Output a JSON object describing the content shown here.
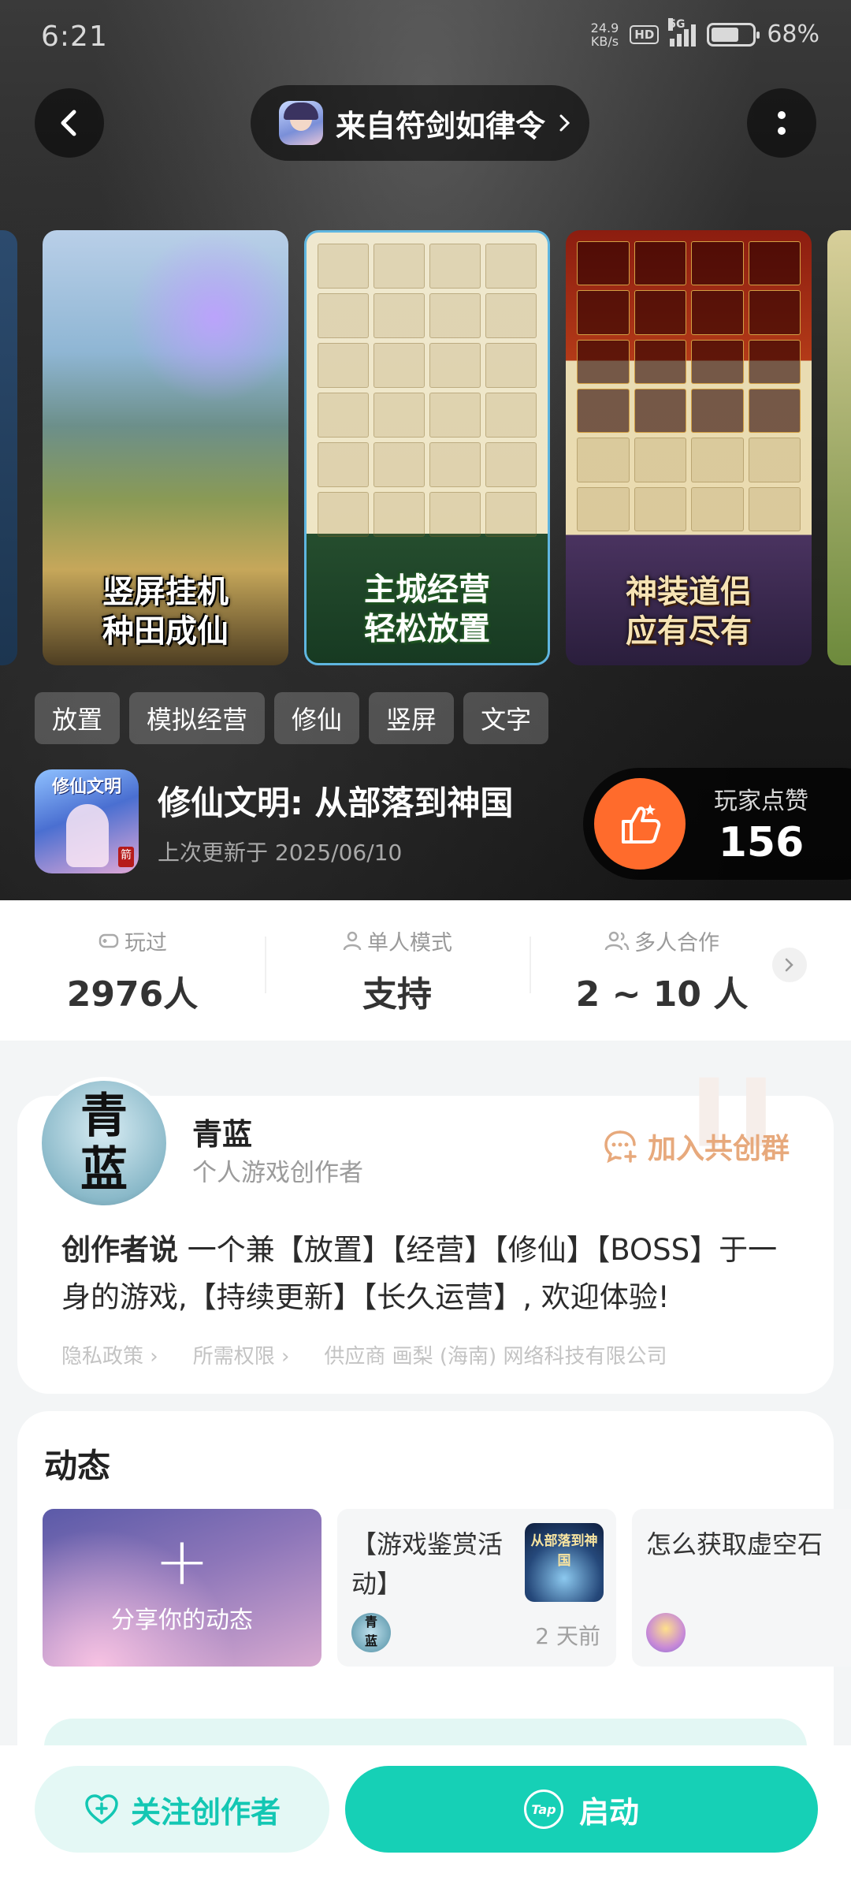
{
  "status_bar": {
    "time": "6:21",
    "network_speed": "24.9",
    "network_unit": "KB/s",
    "hd": "HD",
    "signal": "5G",
    "battery": "68%",
    "battery_level": 0.68
  },
  "header": {
    "source_title": "来自符剑如律令"
  },
  "screenshots": [
    {
      "caption_line1": "竖屏挂机",
      "caption_line2": "种田成仙"
    },
    {
      "caption_line1": "主城经营",
      "caption_line2": "轻松放置"
    },
    {
      "caption_line1": "神装道侣",
      "caption_line2": "应有尽有"
    }
  ],
  "tags": [
    "放置",
    "模拟经营",
    "修仙",
    "竖屏",
    "文字"
  ],
  "game": {
    "icon_text": "修仙文明",
    "icon_badge": "箭",
    "title": "修仙文明: 从部落到神国",
    "updated": "上次更新于 2025/06/10"
  },
  "likes": {
    "label": "玩家点赞",
    "count": "156"
  },
  "stats": [
    {
      "label": "玩过",
      "value": "2976人"
    },
    {
      "label": "单人模式",
      "value": "支持"
    },
    {
      "label": "多人合作",
      "value": "2 ~ 10 人"
    }
  ],
  "creator": {
    "avatar_text_1": "青",
    "avatar_text_2": "蓝",
    "name": "青蓝",
    "role": "个人游戏创作者",
    "join_group": "加入共创群",
    "says_label": "创作者说",
    "says_text": "一个兼【放置】【经营】【修仙】【BOSS】于一身的游戏,【持续更新】【长久运营】, 欢迎体验!",
    "privacy": "隐私政策",
    "permissions": "所需权限",
    "supplier": "供应商 画梨 (海南) 网络科技有限公司"
  },
  "feed": {
    "title": "动态",
    "share_label": "分享你的动态",
    "posts": [
      {
        "text": "【游戏鉴赏活动】",
        "thumb_text": "从部落到神国",
        "time": "2 天前"
      },
      {
        "text": "怎么获取虚空石"
      }
    ]
  },
  "bottom": {
    "follow_label": "关注创作者",
    "launch_label": "启动",
    "tap_logo": "Tap"
  },
  "colors": {
    "accent": "#16d0b6",
    "like_orange": "#ff6b2c",
    "join_group": "#e7a97c"
  }
}
